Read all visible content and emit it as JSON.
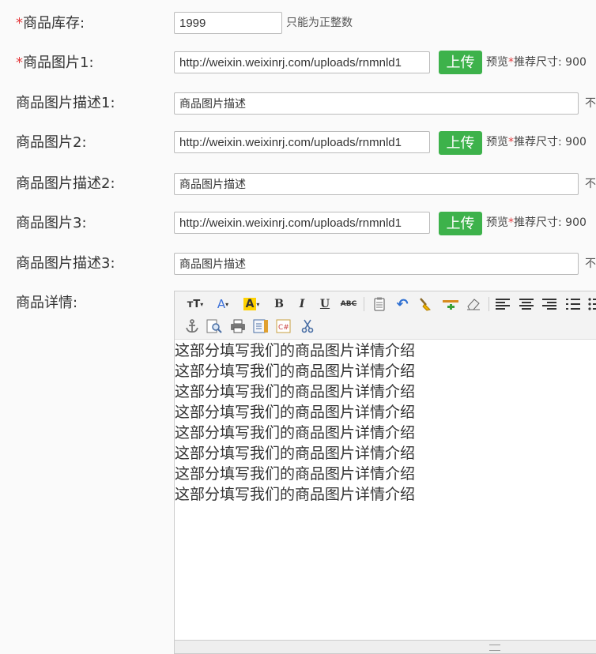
{
  "form": {
    "stock": {
      "label": "商品库存:",
      "value": "1999",
      "hint": "只能为正整数"
    },
    "image1": {
      "label": "商品图片1:",
      "value": "http://weixin.weixinrj.com/uploads/rnmnld1"
    },
    "desc1": {
      "label": "商品图片描述1:",
      "value": "商品图片描述",
      "hint": "不"
    },
    "image2": {
      "label": "商品图片2:",
      "value": "http://weixin.weixinrj.com/uploads/rnmnld1"
    },
    "desc2": {
      "label": "商品图片描述2:",
      "value": "商品图片描述",
      "hint": "不"
    },
    "image3": {
      "label": "商品图片3:",
      "value": "http://weixin.weixinrj.com/uploads/rnmnld1"
    },
    "desc3": {
      "label": "商品图片描述3:",
      "value": "商品图片描述",
      "hint": "不"
    },
    "details": {
      "label": "商品详情:"
    }
  },
  "required_mark": "*",
  "upload_label": "上传",
  "preview": {
    "text": "预览",
    "rec": "推荐尺寸: 900"
  },
  "editor": {
    "lines": [
      "这部分填写我们的商品图片详情介绍",
      "这部分填写我们的商品图片详情介绍",
      "这部分填写我们的商品图片详情介绍",
      "这部分填写我们的商品图片详情介绍",
      "这部分填写我们的商品图片详情介绍",
      "这部分填写我们的商品图片详情介绍",
      "这部分填写我们的商品图片详情介绍",
      "这部分填写我们的商品图片详情介绍"
    ]
  },
  "colors": {
    "accent": "#3db24b",
    "required": "#e4393c"
  }
}
